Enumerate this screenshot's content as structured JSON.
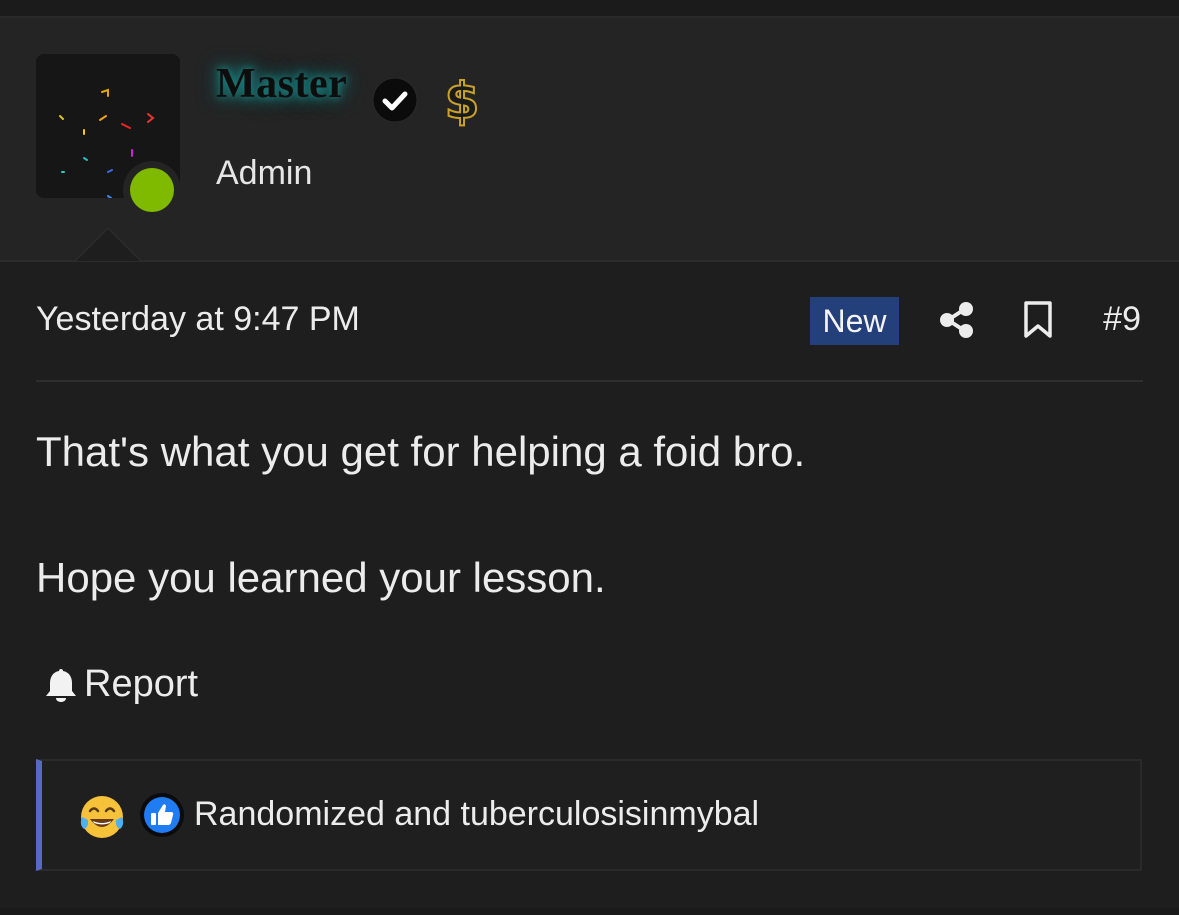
{
  "user": {
    "name": "Master",
    "title": "Admin",
    "online": true,
    "badges": [
      "verified-check-icon",
      "dollar-sign-icon"
    ]
  },
  "post": {
    "date": "Yesterday at 9:47 PM",
    "new_label": "New",
    "number": "#9",
    "lines": [
      "That's what you get for helping a foid bro.",
      "Hope you learned your lesson."
    ],
    "actions": {
      "report_label": "Report"
    }
  },
  "reactions": {
    "icons": [
      "tears-of-joy-emoji",
      "like-icon"
    ],
    "users": "Randomized and tuberculosisinmybal"
  },
  "colors": {
    "background": "#1e1e1e",
    "header_background": "#242424",
    "new_badge": "#23407a",
    "online_dot": "#7fba00",
    "username_glow": "#1d8a8a",
    "dollar_gold": "#c9a227",
    "reaction_accent": "#5968c4",
    "like_blue": "#1f7cf2"
  }
}
